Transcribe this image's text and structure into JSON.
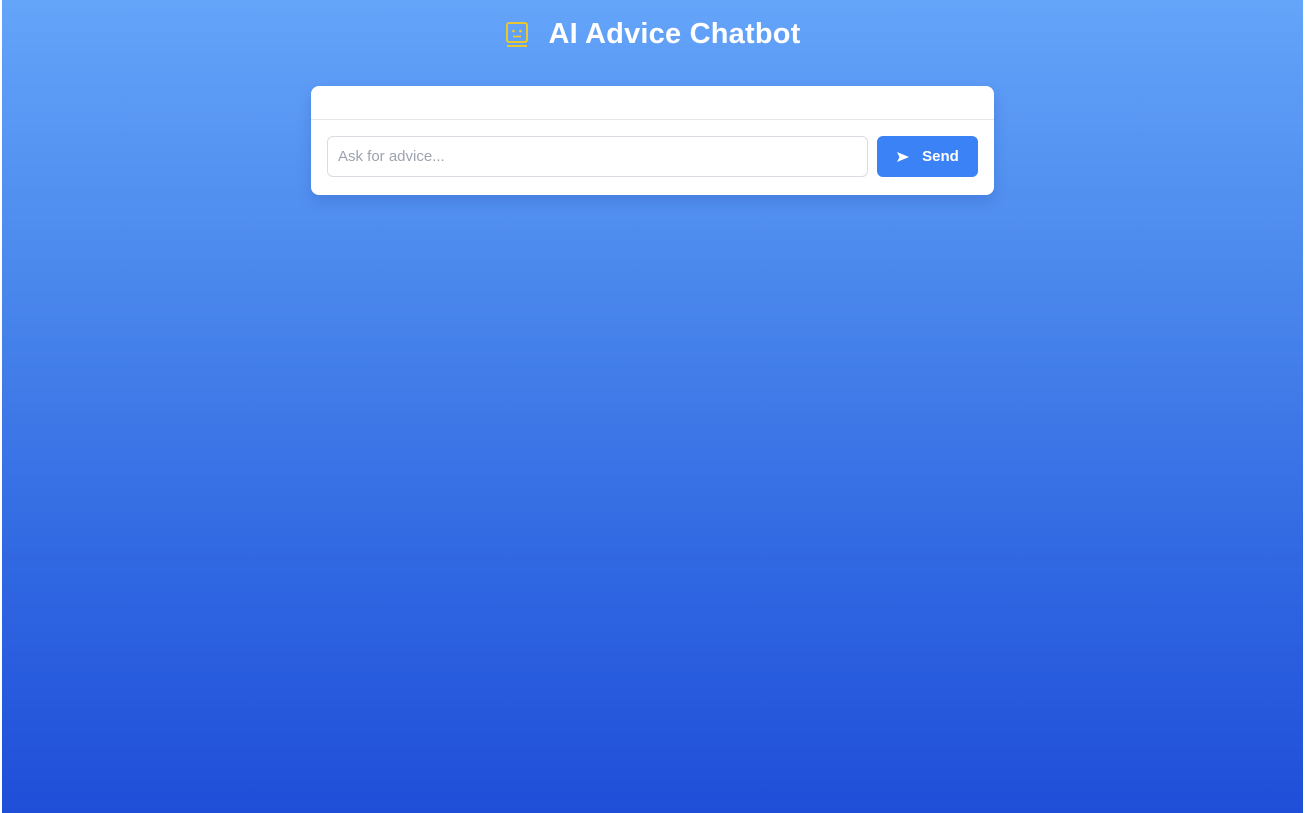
{
  "header": {
    "title": "AI Advice Chatbot",
    "icon": "robot-icon"
  },
  "chat": {
    "messages": [],
    "input": {
      "placeholder": "Ask for advice...",
      "value": ""
    },
    "send_button": {
      "label": "Send",
      "icon": "send-icon"
    }
  },
  "colors": {
    "gradient_top": "#64a4f9",
    "gradient_bottom": "#1f4ed8",
    "accent": "#3b82f6",
    "icon": "#facc15"
  }
}
